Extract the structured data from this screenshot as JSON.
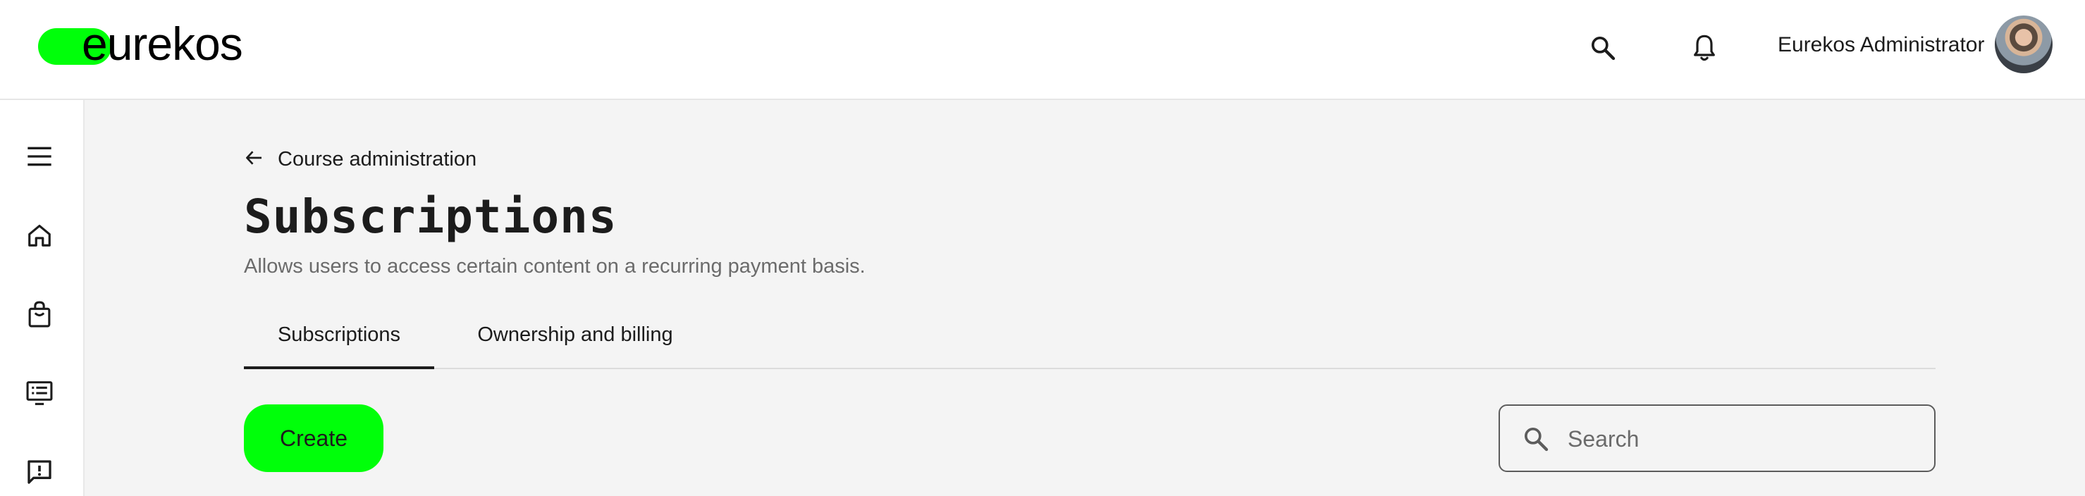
{
  "header": {
    "logo_text": "eurekos",
    "user_name": "Eurekos Administrator",
    "icons": [
      "search-icon",
      "bell-icon"
    ]
  },
  "sidebar": {
    "icons": [
      "menu-icon",
      "home-icon",
      "shopping-bag-icon",
      "course-list-icon",
      "feedback-icon"
    ]
  },
  "breadcrumb": {
    "back_label": "Course administration"
  },
  "page": {
    "title": "Subscriptions",
    "subtitle": "Allows users to access certain content on a recurring payment basis."
  },
  "tabs": [
    {
      "label": "Subscriptions",
      "active": true
    },
    {
      "label": "Ownership and billing",
      "active": false
    }
  ],
  "toolbar": {
    "create_label": "Create",
    "search_placeholder": "Search"
  },
  "colors": {
    "accent": "#00ff0a",
    "text": "#1c1c1c",
    "muted": "#6b6b6b",
    "background": "#f4f4f4"
  }
}
